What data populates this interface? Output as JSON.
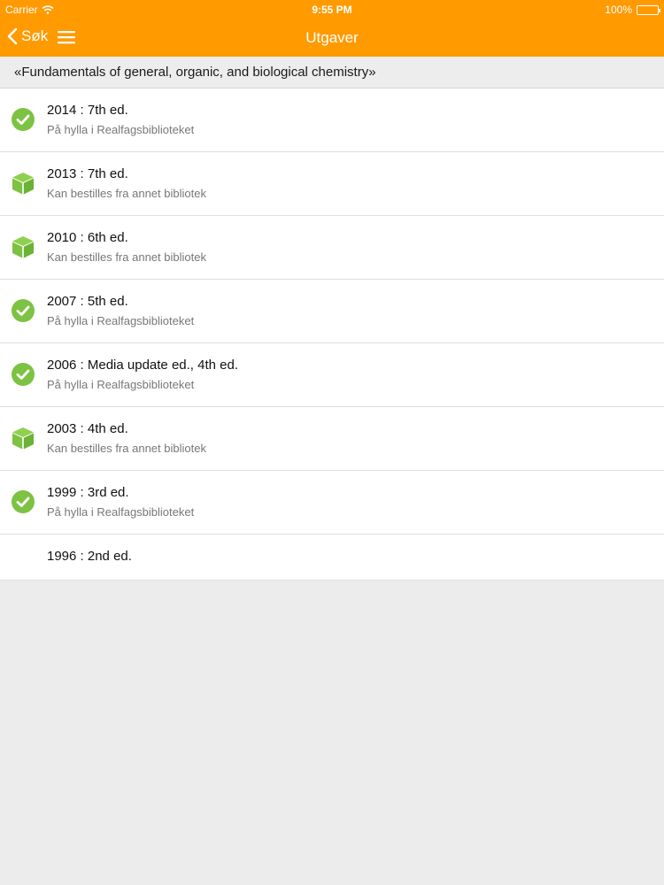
{
  "status": {
    "carrier": "Carrier",
    "time": "9:55 PM",
    "battery": "100%"
  },
  "nav": {
    "back_label": "Søk",
    "title": "Utgaver"
  },
  "work_title": "«Fundamentals of general, organic, and biological chemistry»",
  "colors": {
    "accent": "#ff9a00",
    "available": "#7dc242"
  },
  "editions": [
    {
      "title": "2014 : 7th ed.",
      "status": "På hylla i Realfagsbiblioteket",
      "icon": "check-circle-icon"
    },
    {
      "title": "2013 : 7th ed.",
      "status": "Kan bestilles fra annet bibliotek",
      "icon": "box-icon"
    },
    {
      "title": "2010 : 6th ed.",
      "status": "Kan bestilles fra annet bibliotek",
      "icon": "box-icon"
    },
    {
      "title": "2007 : 5th ed.",
      "status": "På hylla i Realfagsbiblioteket",
      "icon": "check-circle-icon"
    },
    {
      "title": "2006 : Media update ed., 4th ed.",
      "status": "På hylla i Realfagsbiblioteket",
      "icon": "check-circle-icon"
    },
    {
      "title": "2003 : 4th ed.",
      "status": "Kan bestilles fra annet bibliotek",
      "icon": "box-icon"
    },
    {
      "title": "1999 : 3rd ed.",
      "status": "På hylla i Realfagsbiblioteket",
      "icon": "check-circle-icon"
    },
    {
      "title": "1996 : 2nd ed."
    }
  ]
}
